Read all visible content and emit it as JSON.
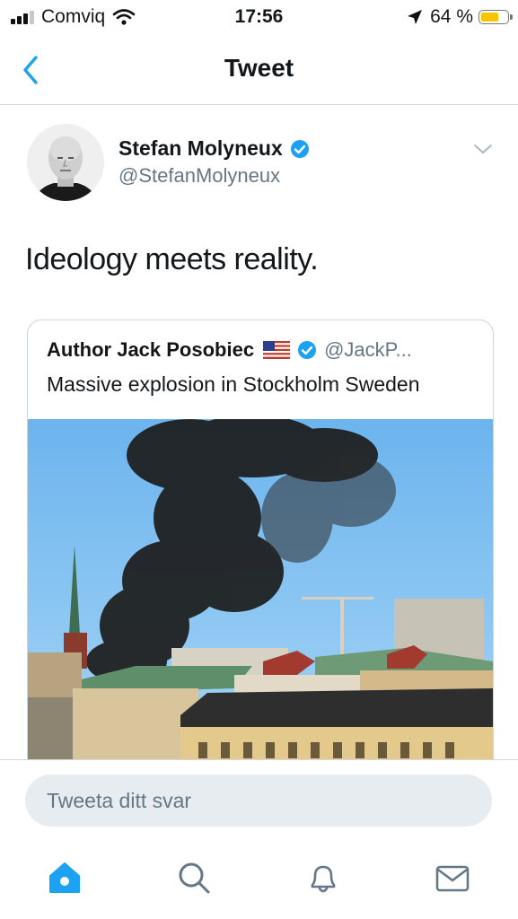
{
  "status_bar": {
    "carrier": "Comviq",
    "time": "17:56",
    "battery_percent": "64 %",
    "battery_level": 0.64
  },
  "nav": {
    "title": "Tweet",
    "back_icon": "chevron-left-icon"
  },
  "tweet": {
    "author_name": "Stefan Molyneux",
    "author_handle": "@StefanMolyneux",
    "verified": true,
    "text": "Ideology meets reality."
  },
  "quoted_tweet": {
    "author_name": "Author Jack Posobiec",
    "flag": "us-flag-icon",
    "verified": true,
    "author_handle": "@JackP...",
    "text": "Massive explosion in Stockholm Sweden"
  },
  "reply": {
    "placeholder": "Tweeta ditt svar"
  },
  "tab_bar": {
    "items": [
      "home-icon",
      "search-icon",
      "notifications-bell-icon",
      "messages-envelope-icon"
    ],
    "active": "home-icon"
  },
  "colors": {
    "accent": "#1da1f2",
    "muted": "#657786",
    "reply_bg": "#e6ecf0",
    "battery": "#f6c400"
  }
}
